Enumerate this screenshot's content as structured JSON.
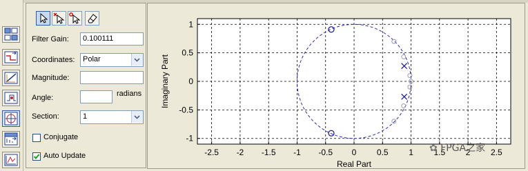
{
  "toolbar": {
    "icons": [
      "pole-zero-editor-icon",
      "magnitude-response-icon",
      "phase-response-icon",
      "group-delay-icon",
      "impulse-response-icon",
      "step-response-icon",
      "pole-zero-plot-icon"
    ]
  },
  "tools": {
    "icons": [
      "pointer-icon",
      "add-zero-icon",
      "add-pole-icon",
      "eraser-icon"
    ]
  },
  "form": {
    "filter_gain_label": "Filter Gain:",
    "filter_gain_value": "0.100111",
    "coordinates_label": "Coordinates:",
    "coordinates_value": "Polar",
    "magnitude_label": "Magnitude:",
    "magnitude_value": "",
    "angle_label": "Angle:",
    "angle_value": "",
    "angle_unit": "radians",
    "section_label": "Section:",
    "section_value": "1",
    "conjugate_label": "Conjugate",
    "conjugate_checked": false,
    "auto_update_label": "Auto Update",
    "auto_update_checked": true
  },
  "chart_data": {
    "type": "scatter",
    "xlabel": "Real Part",
    "ylabel": "Imaginary Part",
    "xlim": [
      -2.75,
      2.75
    ],
    "ylim": [
      -1.1,
      1.1
    ],
    "xticks": [
      "-2.5",
      "-2",
      "-1.5",
      "-1",
      "-0.5",
      "0",
      "0.5",
      "1",
      "1.5",
      "2",
      "2.5"
    ],
    "xtick_values": [
      -2.5,
      -2,
      -1.5,
      -1,
      -0.5,
      0,
      0.5,
      1,
      1.5,
      2,
      2.5
    ],
    "yticks": [
      "1",
      "0.5",
      "0",
      "-0.5",
      "-1"
    ],
    "ytick_values": [
      1,
      0.5,
      0,
      -0.5,
      -1
    ],
    "grid": true,
    "unit_circle": true,
    "series": [
      {
        "marker": "o",
        "color": "#1f1fa0",
        "points": [
          [
            -0.4,
            0.91
          ],
          [
            -0.4,
            -0.91
          ]
        ]
      },
      {
        "marker": "x",
        "color": "#1f1fa0",
        "points": [
          [
            0.88,
            0.27
          ],
          [
            0.88,
            -0.27
          ]
        ]
      },
      {
        "marker": "o-faded",
        "color": "#9a9aa8",
        "points": [
          [
            0.7,
            0.7
          ],
          [
            0.7,
            -0.7
          ],
          [
            0.87,
            0.43
          ],
          [
            0.87,
            -0.43
          ],
          [
            0.98,
            0.1
          ],
          [
            0.98,
            -0.1
          ],
          [
            1.0,
            0.0
          ]
        ]
      }
    ]
  },
  "watermark": "FPGA之家"
}
